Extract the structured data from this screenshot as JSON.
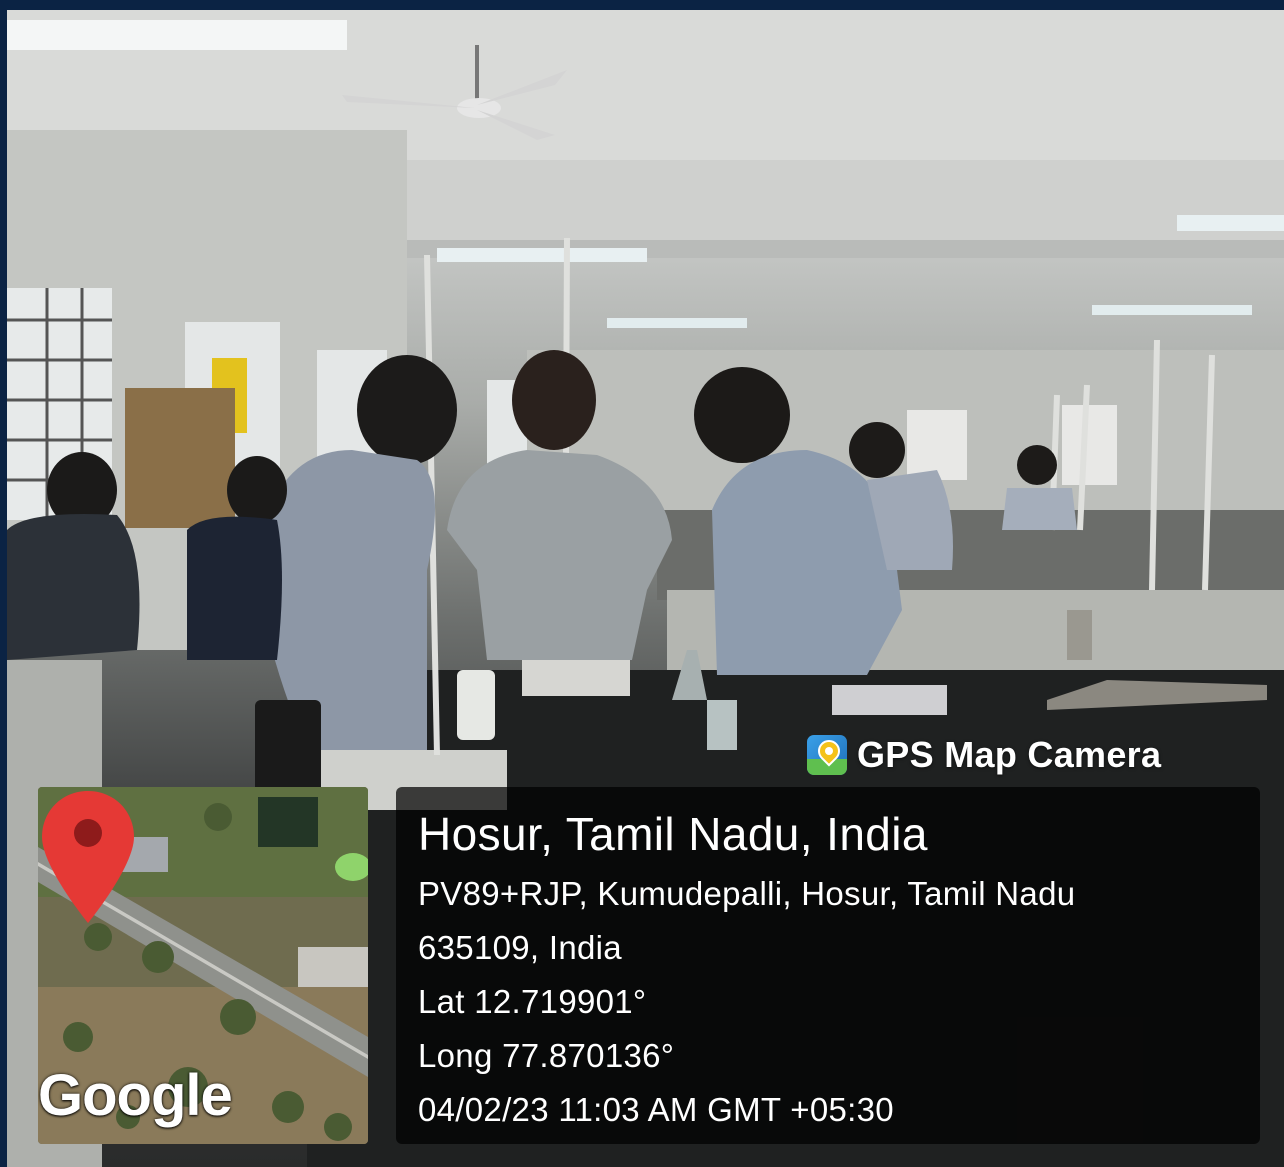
{
  "photo": {
    "subject": ""
  },
  "overlay": {
    "brand_label": "GPS Map Camera",
    "brand_icon": "gps-map-camera-icon",
    "location_title": "Hosur, Tamil Nadu, India",
    "address_line_1": "PV89+RJP, Kumudepalli, Hosur, Tamil Nadu",
    "address_line_2": "635109, India",
    "latitude": "Lat 12.719901°",
    "longitude": "Long 77.870136°",
    "timestamp": "04/02/23 11:03 AM GMT +05:30",
    "panel_color": "#000000",
    "text_color": "#ffffff"
  },
  "map": {
    "logo_text": "Google",
    "pin_icon": "map-pin-icon",
    "pin_color": "#e53935"
  }
}
